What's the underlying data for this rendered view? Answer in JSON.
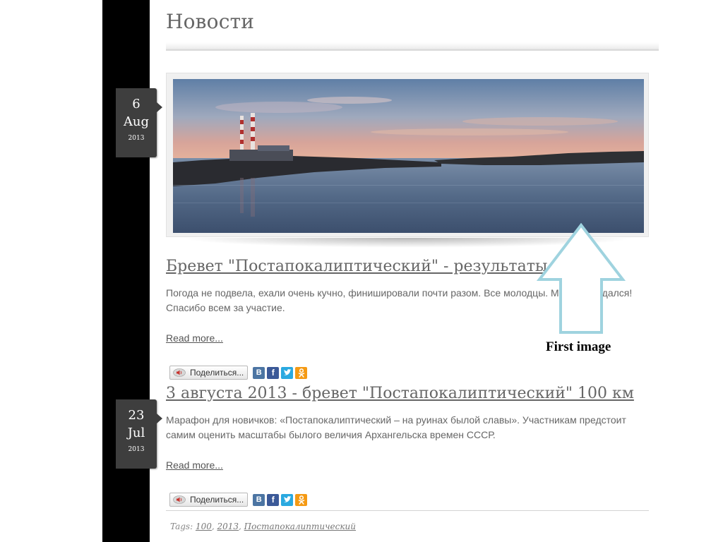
{
  "header": {
    "title": "Новости"
  },
  "posts": [
    {
      "date": {
        "day": "6",
        "month": "Aug",
        "year": "2013"
      },
      "title": "Бревет \"Постапокалиптический\" - результаты",
      "excerpt": "Погода не подвела, ехали очень кучно, финишировали почти разом. Все молодцы. Марафон удался! Спасибо всем за участие.",
      "read_more": "Read more...",
      "share_label": "Поделиться..."
    },
    {
      "date": {
        "day": "23",
        "month": "Jul",
        "year": "2013"
      },
      "title": "3 августа 2013 - бревет \"Постапокалиптический\" 100 км",
      "excerpt": "Марафон для новичков: «Постапокалиптический – на руинах былой славы». Участникам предстоит самим оценить масштабы былого величия Архангельска времен СССР.",
      "read_more": "Read more...",
      "share_label": "Поделиться..."
    }
  ],
  "social": {
    "vk": "В",
    "fb": "f",
    "ok": "ок"
  },
  "tags": {
    "label": "Tags:",
    "items": [
      "100",
      "2013",
      "Постапокалиптический"
    ]
  },
  "annotation": {
    "label": "First image",
    "arrow_color": "#9fd3df"
  },
  "colors": {
    "sidebar": "#000000",
    "badge": "#3e3e3e",
    "text": "#666666"
  }
}
